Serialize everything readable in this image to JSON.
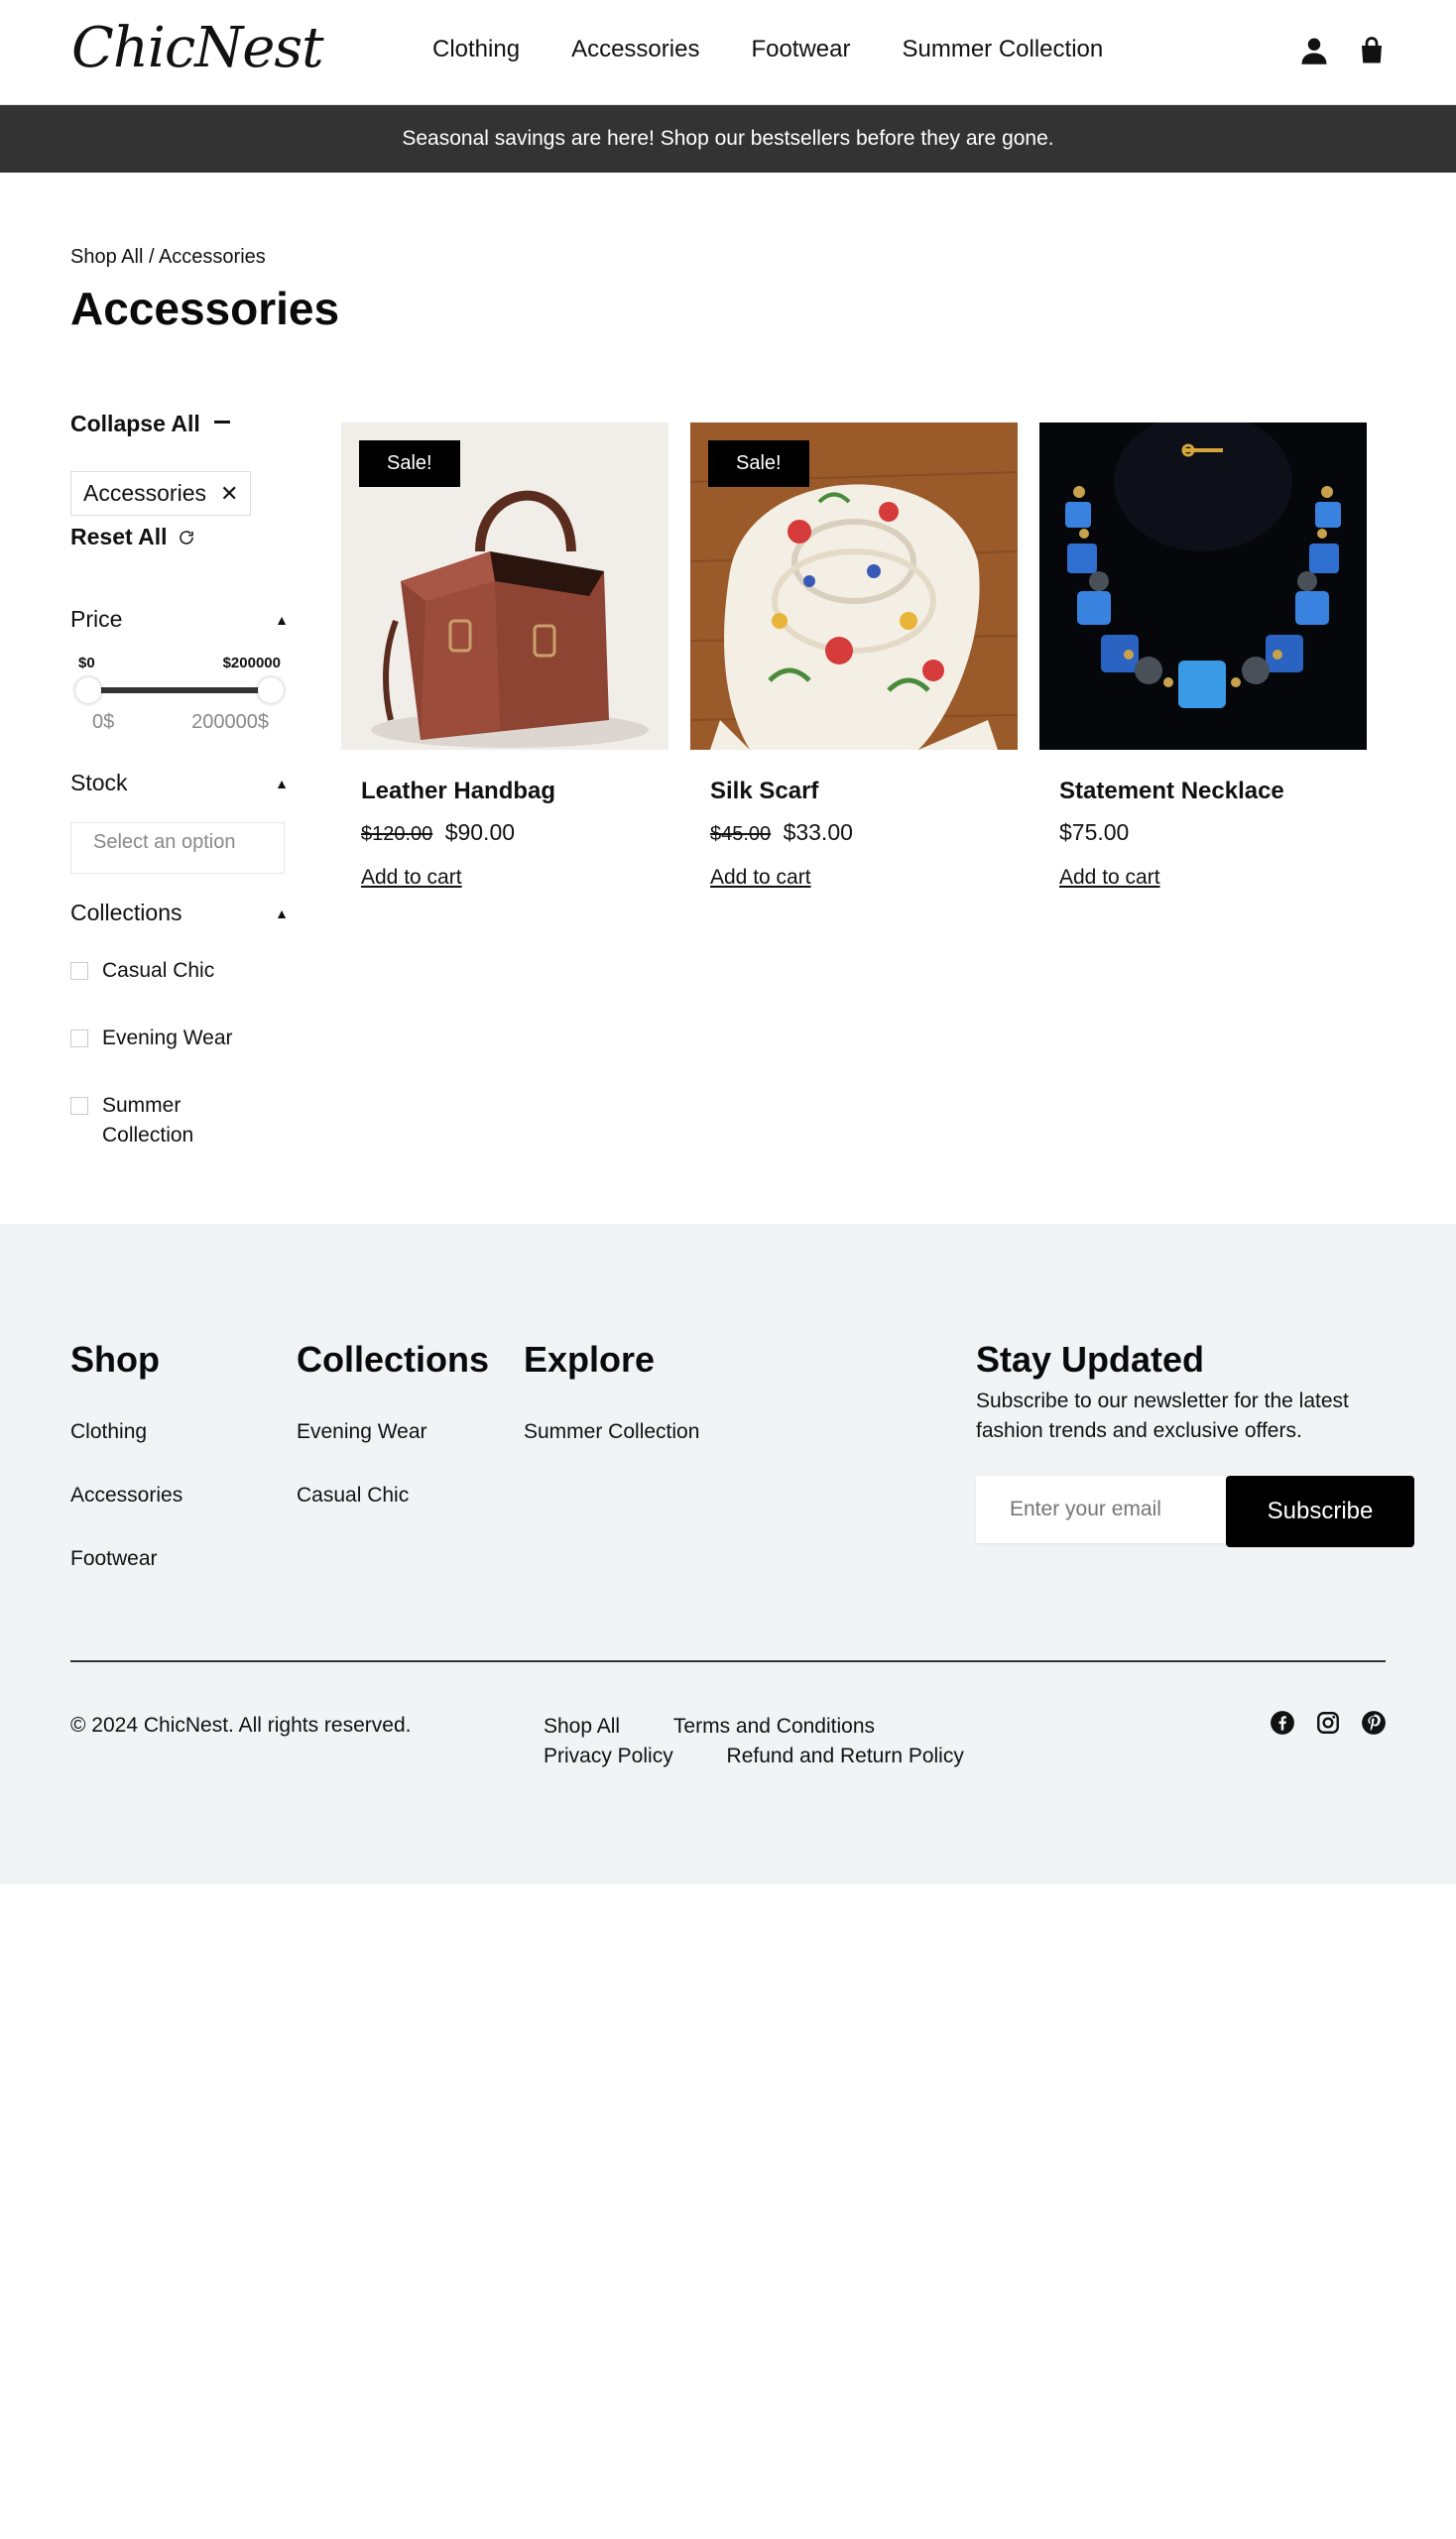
{
  "header": {
    "logo": "ChicNest",
    "nav": [
      "Clothing",
      "Accessories",
      "Footwear",
      "Summer Collection"
    ],
    "icons": [
      "user-icon",
      "shopping-bag-icon"
    ]
  },
  "announcement": "Seasonal savings are here! Shop our bestsellers before they are gone.",
  "breadcrumb": "Shop All / Accessories",
  "page_title": "Accessories",
  "sidebar": {
    "collapse_all": "Collapse All",
    "active_filter": "Accessories",
    "reset_all": "Reset All",
    "price": {
      "label": "Price",
      "min_label": "$0",
      "max_label": "$200000",
      "min_value": "0$",
      "max_value": "200000$"
    },
    "stock": {
      "label": "Stock",
      "placeholder": "Select an option"
    },
    "collections": {
      "label": "Collections",
      "items": [
        "Casual Chic",
        "Evening Wear",
        "Summer Collection"
      ]
    }
  },
  "products": [
    {
      "name": "Leather Handbag",
      "old_price": "$120.00",
      "price": "$90.00",
      "badge": "Sale!",
      "cta": "Add to cart"
    },
    {
      "name": "Silk Scarf",
      "old_price": "$45.00",
      "price": "$33.00",
      "badge": "Sale!",
      "cta": "Add to cart"
    },
    {
      "name": "Statement Necklace",
      "price": "$75.00",
      "cta": "Add to cart"
    }
  ],
  "footer": {
    "shop": {
      "title": "Shop",
      "links": [
        "Clothing",
        "Accessories",
        "Footwear"
      ]
    },
    "collections": {
      "title": "Collections",
      "links": [
        "Evening Wear",
        "Casual Chic"
      ]
    },
    "explore": {
      "title": "Explore",
      "links": [
        "Summer Collection"
      ]
    },
    "newsletter": {
      "title": "Stay Updated",
      "text": "Subscribe to our newsletter for the latest fashion trends and exclusive offers.",
      "placeholder": "Enter your email",
      "button": "Subscribe"
    },
    "copyright": "© 2024 ChicNest. All rights reserved.",
    "legal": [
      "Shop All",
      "Terms and Conditions",
      "Privacy Policy",
      "Refund and Return Policy"
    ],
    "socials": [
      "facebook-icon",
      "instagram-icon",
      "pinterest-icon"
    ]
  }
}
